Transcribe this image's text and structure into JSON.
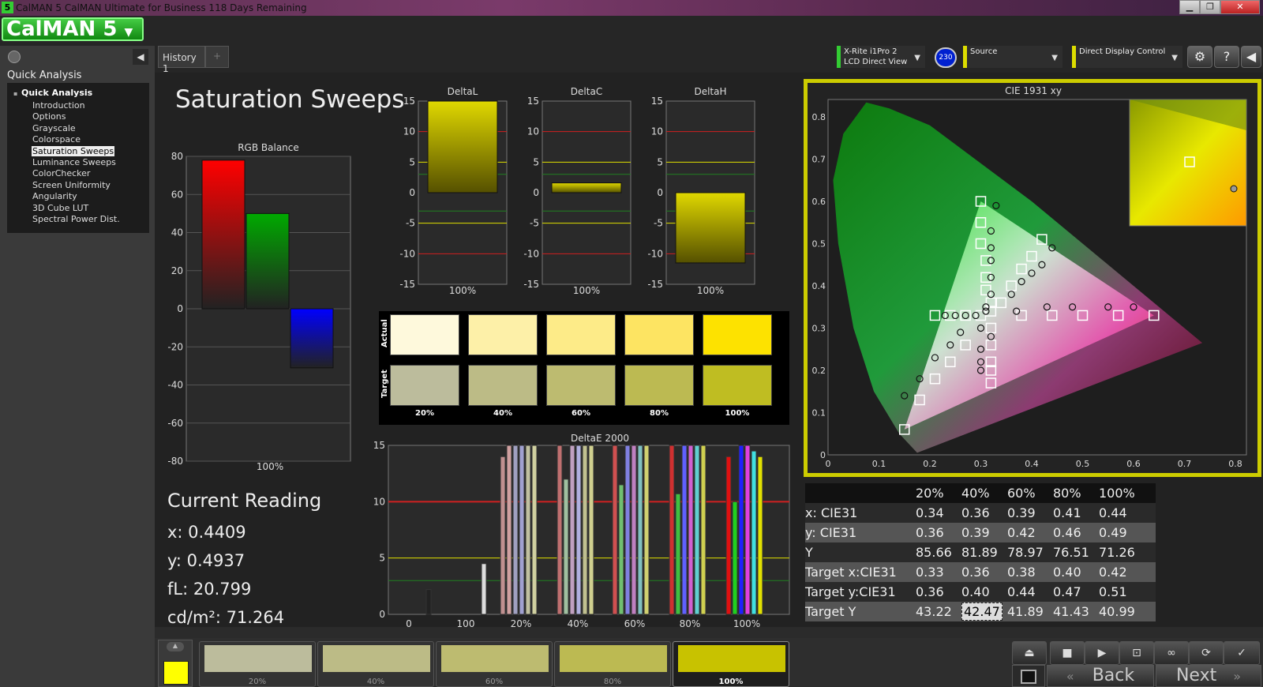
{
  "window": {
    "title": "CalMAN 5 CalMAN Ultimate for Business 118 Days Remaining",
    "icon_text": "5",
    "min": "▁",
    "max": "❐",
    "close": "✕"
  },
  "logo": {
    "text": "CalMAN 5"
  },
  "sidebar": {
    "header": "Quick Analysis",
    "root": "Quick Analysis",
    "items": [
      "Introduction",
      "Options",
      "Grayscale",
      "Colorspace",
      "Saturation Sweeps",
      "Luminance Sweeps",
      "ColorChecker",
      "Screen Uniformity",
      "Angularity",
      "3D Cube LUT",
      "Spectral Power Dist."
    ],
    "selected_index": 4
  },
  "tabs": {
    "history": "History 1",
    "add": "+"
  },
  "devices": {
    "meter_line1": "X-Rite i1Pro 2",
    "meter_line2": "LCD Direct View",
    "meter_badge": "230",
    "source": "Source",
    "display": "Direct Display Control"
  },
  "page_title": "Saturation Sweeps",
  "rgb_balance": {
    "title": "RGB Balance",
    "ylim": [
      -80,
      80
    ],
    "ticks": [
      "80",
      "60",
      "40",
      "20",
      "0",
      "-20",
      "-40",
      "-60",
      "-80"
    ],
    "category": "100%",
    "values": [
      78,
      50,
      -31
    ],
    "colors": [
      "#ff0000",
      "#00aa00",
      "#0000ff"
    ]
  },
  "delta_charts": [
    {
      "title": "DeltaL",
      "value": 15,
      "category": "100%"
    },
    {
      "title": "DeltaC",
      "value": 1.6,
      "category": "100%"
    },
    {
      "title": "DeltaH",
      "value": -11.5,
      "category": "100%"
    }
  ],
  "delta_ticks": [
    "15",
    "10",
    "5",
    "0",
    "-5",
    "-10",
    "-15"
  ],
  "swatch_labels": {
    "actual": "Actual",
    "target": "Target",
    "steps": [
      "20%",
      "40%",
      "60%",
      "80%",
      "100%"
    ]
  },
  "swatch_colors": {
    "actual": [
      "#fef9dc",
      "#fdf0a8",
      "#fdeb88",
      "#fde462",
      "#fde200"
    ],
    "target": [
      "#bcbc9c",
      "#bcbb86",
      "#bdbb70",
      "#bcba52",
      "#bfbd22"
    ]
  },
  "deltae": {
    "title": "DeltaE 2000",
    "yticks": [
      "15",
      "10",
      "5",
      "0"
    ],
    "xlabels": [
      "0",
      "100",
      "20%",
      "40%",
      "60%",
      "80%",
      "100%"
    ],
    "red_line": 10,
    "yellow_line": 5,
    "green_line": 3
  },
  "current_reading": {
    "title": "Current Reading",
    "x": "x: 0.4409",
    "y": "y: 0.4937",
    "fl": "fL: 20.799",
    "cdm2": "cd/m²: 71.264"
  },
  "cie": {
    "title": "CIE 1931 xy",
    "xticks": [
      "0",
      "0.1",
      "0.2",
      "0.3",
      "0.4",
      "0.5",
      "0.6",
      "0.7",
      "0.8"
    ],
    "yticks": [
      "0.8",
      "0.7",
      "0.6",
      "0.5",
      "0.4",
      "0.3",
      "0.2",
      "0.1",
      "0"
    ],
    "targets": [
      [
        0.3,
        0.6
      ],
      [
        0.3,
        0.55
      ],
      [
        0.3,
        0.5
      ],
      [
        0.31,
        0.46
      ],
      [
        0.31,
        0.42
      ],
      [
        0.31,
        0.39
      ],
      [
        0.32,
        0.36
      ],
      [
        0.32,
        0.34
      ],
      [
        0.42,
        0.51
      ],
      [
        0.4,
        0.47
      ],
      [
        0.38,
        0.44
      ],
      [
        0.36,
        0.4
      ],
      [
        0.34,
        0.36
      ],
      [
        0.64,
        0.33
      ],
      [
        0.57,
        0.33
      ],
      [
        0.5,
        0.33
      ],
      [
        0.44,
        0.33
      ],
      [
        0.38,
        0.33
      ],
      [
        0.15,
        0.06
      ],
      [
        0.18,
        0.13
      ],
      [
        0.21,
        0.18
      ],
      [
        0.24,
        0.22
      ],
      [
        0.27,
        0.26
      ],
      [
        0.32,
        0.3
      ],
      [
        0.32,
        0.26
      ],
      [
        0.32,
        0.22
      ],
      [
        0.32,
        0.2
      ],
      [
        0.32,
        0.17
      ],
      [
        0.21,
        0.33
      ],
      [
        0.24,
        0.33
      ],
      [
        0.27,
        0.33
      ],
      [
        0.3,
        0.33
      ]
    ],
    "actuals": [
      [
        0.33,
        0.59
      ],
      [
        0.32,
        0.53
      ],
      [
        0.32,
        0.49
      ],
      [
        0.32,
        0.46
      ],
      [
        0.32,
        0.42
      ],
      [
        0.32,
        0.38
      ],
      [
        0.31,
        0.35
      ],
      [
        0.44,
        0.49
      ],
      [
        0.42,
        0.45
      ],
      [
        0.4,
        0.43
      ],
      [
        0.38,
        0.41
      ],
      [
        0.36,
        0.38
      ],
      [
        0.6,
        0.35
      ],
      [
        0.55,
        0.35
      ],
      [
        0.48,
        0.35
      ],
      [
        0.43,
        0.35
      ],
      [
        0.37,
        0.34
      ],
      [
        0.15,
        0.14
      ],
      [
        0.18,
        0.18
      ],
      [
        0.21,
        0.23
      ],
      [
        0.24,
        0.26
      ],
      [
        0.26,
        0.29
      ],
      [
        0.3,
        0.3
      ],
      [
        0.32,
        0.28
      ],
      [
        0.3,
        0.25
      ],
      [
        0.3,
        0.22
      ],
      [
        0.3,
        0.2
      ],
      [
        0.23,
        0.33
      ],
      [
        0.25,
        0.33
      ],
      [
        0.27,
        0.33
      ],
      [
        0.29,
        0.33
      ],
      [
        0.31,
        0.34
      ]
    ]
  },
  "table": {
    "columns": [
      "",
      "20%",
      "40%",
      "60%",
      "80%",
      "100%"
    ],
    "rows": [
      {
        "label": "x: CIE31",
        "values": [
          "0.34",
          "0.36",
          "0.39",
          "0.41",
          "0.44"
        ]
      },
      {
        "label": "y: CIE31",
        "values": [
          "0.36",
          "0.39",
          "0.42",
          "0.46",
          "0.49"
        ]
      },
      {
        "label": "Y",
        "values": [
          "85.66",
          "81.89",
          "78.97",
          "76.51",
          "71.26"
        ]
      },
      {
        "label": "Target x:CIE31",
        "values": [
          "0.33",
          "0.36",
          "0.38",
          "0.40",
          "0.42"
        ]
      },
      {
        "label": "Target y:CIE31",
        "values": [
          "0.36",
          "0.40",
          "0.44",
          "0.47",
          "0.51"
        ]
      },
      {
        "label": "Target Y",
        "values": [
          "43.22",
          "42.47",
          "41.89",
          "41.43",
          "40.99"
        ]
      }
    ]
  },
  "bottom": {
    "steps": [
      "20%",
      "40%",
      "60%",
      "80%",
      "100%"
    ],
    "colors": [
      "#bcbc9c",
      "#bcbb86",
      "#bdbb70",
      "#bcba52",
      "#c8c200"
    ],
    "active_color": "#ffff00",
    "back": "Back",
    "next": "Next"
  }
}
